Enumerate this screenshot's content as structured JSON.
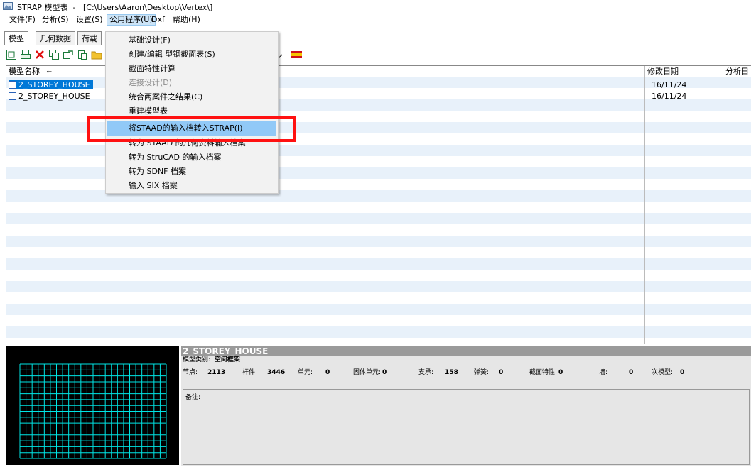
{
  "window": {
    "title": "STRAP 模型表  -   [C:\\Users\\Aaron\\Desktop\\Vertex\\]"
  },
  "menubar": {
    "items": [
      "文件(F)",
      "分析(S)",
      "设置(S)",
      "公用程序(U)",
      "Dxf",
      "帮助(H)"
    ],
    "active": "公用程序(U)"
  },
  "tabs": {
    "items": [
      "模型",
      "几何数据",
      "荷载"
    ],
    "selected": "模型"
  },
  "toolbar": {
    "icons": [
      "new-model-icon",
      "print-icon",
      "delete-icon",
      "copy-icon",
      "copy-to-icon",
      "paste-icon",
      "folder-icon",
      "pointer-icon",
      "spain-flag-icon"
    ]
  },
  "list": {
    "columns": [
      "模型名称",
      "修改日期",
      "分析日"
    ],
    "rows": [
      {
        "name": "2_STOREY_HOUSE",
        "date": "16/11/24",
        "selected": true
      },
      {
        "name": "2_STOREY_HOUSE",
        "date": "16/11/24",
        "selected": false
      }
    ]
  },
  "dropdown": {
    "items": [
      {
        "label": "基础设计(F)",
        "disabled": false
      },
      {
        "label": "创建/编辑 型钢截面表(S)",
        "disabled": false
      },
      {
        "label": "截面特性计算",
        "disabled": false
      },
      {
        "label": "连接设计(D)",
        "disabled": true
      },
      {
        "label": "统合两案件之结果(C)",
        "disabled": false
      },
      {
        "label": "重建模型表",
        "disabled": false
      },
      {
        "label": "将STAAD的输入档转入STRAP(I)",
        "disabled": false,
        "highlighted": true
      },
      {
        "label": "转为 STAAD 的几何资料输入档案",
        "disabled": false
      },
      {
        "label": "转为 StruCAD 的输入档案",
        "disabled": false
      },
      {
        "label": "转为 SDNF 档案",
        "disabled": false
      },
      {
        "label": "输入 SIX 档案",
        "disabled": false
      }
    ]
  },
  "info": {
    "title": "2_STOREY_HOUSE",
    "type_label": "模型类别:",
    "type_value": "空间框架",
    "stats": [
      {
        "label": "节点:",
        "value": "2113"
      },
      {
        "label": "杆件:",
        "value": "3446"
      },
      {
        "label": "单元:",
        "value": "0"
      },
      {
        "label": "固体单元:",
        "value": "0"
      },
      {
        "label": "支承:",
        "value": "158"
      },
      {
        "label": "弹簧:",
        "value": "0"
      },
      {
        "label": "截面特性:",
        "value": "0"
      },
      {
        "label": "墙:",
        "value": "0"
      },
      {
        "label": "次模型:",
        "value": "0"
      }
    ],
    "notes_label": "备注:"
  },
  "colors": {
    "highlight": "#91c9f7",
    "selection": "#0078d7",
    "annotation": "#ff1111",
    "preview_lines": "#00e5e5"
  }
}
